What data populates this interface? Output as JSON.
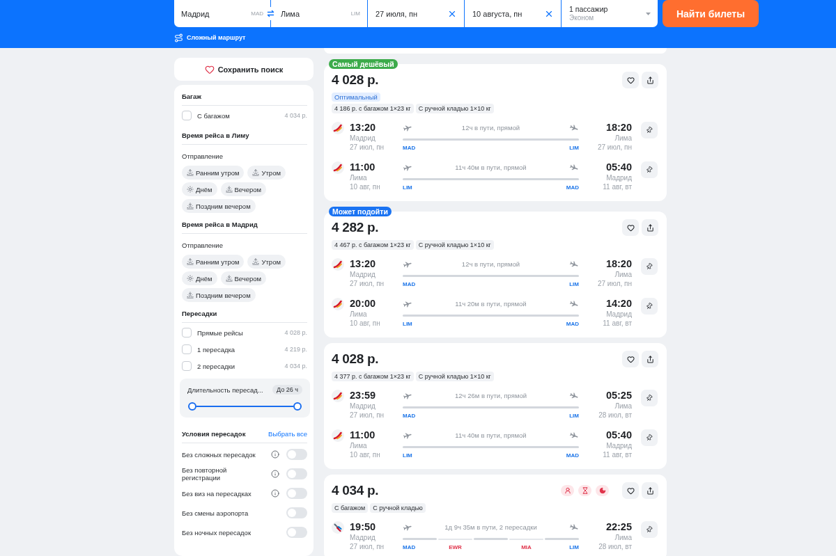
{
  "search_form": {
    "origin": {
      "city": "Мадрид",
      "code": "MAD"
    },
    "destination": {
      "city": "Лима",
      "code": "LIM"
    },
    "departure_date": "27 июля, пн",
    "return_date": "10 августа, пн",
    "passengers": "1 пассажир",
    "cabin_class": "Эконом",
    "search_button": "Найти билеты",
    "complex_route_link": "Сложный маршрут"
  },
  "sidebar": {
    "save_search_button": "Сохранить поиск",
    "sections": [
      {
        "kind": "checkboxes",
        "title": "Багаж",
        "items": [
          {
            "label": "С багажом",
            "price": "4 034 р.",
            "checked": false
          }
        ]
      },
      {
        "kind": "times",
        "title": "Время рейса в Лиму",
        "subtitle": "Отправление",
        "chips": [
          {
            "kind": "sunrise",
            "label": "Ранним утром",
            "selected": false
          },
          {
            "kind": "sunrise",
            "label": "Утром",
            "selected": false
          },
          {
            "kind": "sun",
            "label": "Днём",
            "selected": false
          },
          {
            "kind": "sunset",
            "label": "Вечером",
            "selected": false
          },
          {
            "kind": "sunset",
            "label": "Поздним вечером",
            "selected": false
          }
        ]
      },
      {
        "kind": "times",
        "title": "Время рейса в Мадрид",
        "subtitle": "Отправление",
        "chips": [
          {
            "kind": "sunrise",
            "label": "Ранним утром",
            "selected": false
          },
          {
            "kind": "sunrise",
            "label": "Утром",
            "selected": false
          },
          {
            "kind": "sun",
            "label": "Днём",
            "selected": false
          },
          {
            "kind": "sunset",
            "label": "Вечером",
            "selected": false
          },
          {
            "kind": "sunset",
            "label": "Поздним вечером",
            "selected": false
          }
        ]
      },
      {
        "kind": "checkboxes",
        "title": "Пересадки",
        "items": [
          {
            "label": "Прямые рейсы",
            "price": "4 028 р.",
            "checked": false
          },
          {
            "label": "1 пересадка",
            "price": "4 219 р.",
            "checked": false
          },
          {
            "label": "2 пересадки",
            "price": "4 034 р.",
            "checked": false
          }
        ],
        "duration_filter": {
          "label": "Длительность пересад...",
          "value": "До 26 ч",
          "thumbs": [
            {
              "level": 0
            },
            {
              "level": 1
            }
          ]
        }
      },
      {
        "kind": "toggles",
        "title": "Условия пересадок",
        "action": "Выбрать все",
        "items": [
          {
            "label": "Без сложных пересадок",
            "info": true,
            "on": false
          },
          {
            "label": "Без повторной регистрации",
            "info": true,
            "on": false
          },
          {
            "label": "Без виз на пересадках",
            "info": true,
            "on": false
          },
          {
            "label": "Без смены аэропорта",
            "info": false,
            "on": false
          },
          {
            "label": "Без ночных пересадок",
            "info": false,
            "on": false
          }
        ]
      }
    ]
  },
  "results": [
    {
      "badge": {
        "text": "Самый дешёвый",
        "color": "#3dab4b"
      },
      "price": "4 028 р.",
      "rating_tag": "Оптимальный",
      "tags": [
        "4 186 р. с багажом 1×23 кг",
        "С ручной кладью 1×10 кг"
      ],
      "segments": [
        {
          "airline_logo": {
            "kind": "swoosh"
          },
          "departure_time": "13:20",
          "departure_city": "Мадрид",
          "departure_date": "27 июл, пн",
          "duration": "12ч в пути, прямой",
          "from_code": "MAD",
          "to_code": "LIM",
          "arrival_time": "18:20",
          "arrival_city": "Лима",
          "arrival_date": "27 июл, пн"
        },
        {
          "airline_logo": {
            "kind": "swoosh"
          },
          "departure_time": "11:00",
          "departure_city": "Лима",
          "departure_date": "10 авг, пн",
          "duration": "11ч 40м в пути, прямой",
          "from_code": "LIM",
          "to_code": "MAD",
          "arrival_time": "05:40",
          "arrival_city": "Мадрид",
          "arrival_date": "11 авг, вт"
        }
      ]
    },
    {
      "badge": {
        "text": "Может подойти",
        "color": "#1a73f2"
      },
      "price": "4 282 р.",
      "tags": [
        "4 467 р. с багажом 1×23 кг",
        "С ручной кладью 1×10 кг"
      ],
      "segments": [
        {
          "airline_logo": {
            "kind": "swoosh"
          },
          "departure_time": "13:20",
          "departure_city": "Мадрид",
          "departure_date": "27 июл, пн",
          "duration": "12ч в пути, прямой",
          "from_code": "MAD",
          "to_code": "LIM",
          "arrival_time": "18:20",
          "arrival_city": "Лима",
          "arrival_date": "27 июл, пн"
        },
        {
          "airline_logo": {
            "kind": "swoosh"
          },
          "departure_time": "20:00",
          "departure_city": "Лима",
          "departure_date": "10 авг, пн",
          "duration": "11ч 20м в пути, прямой",
          "from_code": "LIM",
          "to_code": "MAD",
          "arrival_time": "14:20",
          "arrival_city": "Мадрид",
          "arrival_date": "11 авг, вт"
        }
      ]
    },
    {
      "price": "4 028 р.",
      "tags": [
        "4 377 р. с багажом 1×23 кг",
        "С ручной кладью 1×10 кг"
      ],
      "segments": [
        {
          "airline_logo": {
            "kind": "swoosh"
          },
          "departure_time": "23:59",
          "departure_city": "Мадрид",
          "departure_date": "27 июл, пн",
          "duration": "12ч 26м в пути, прямой",
          "from_code": "MAD",
          "to_code": "LIM",
          "arrival_time": "05:25",
          "arrival_city": "Лима",
          "arrival_date": "28 июл, вт"
        },
        {
          "airline_logo": {
            "kind": "swoosh"
          },
          "departure_time": "11:00",
          "departure_city": "Лима",
          "departure_date": "10 авг, пн",
          "duration": "11ч 40м в пути, прямой",
          "from_code": "LIM",
          "to_code": "MAD",
          "arrival_time": "05:40",
          "arrival_city": "Мадрид",
          "arrival_date": "11 авг, вт"
        }
      ]
    },
    {
      "price": "4 034 р.",
      "warnings": [
        {
          "kind": "person"
        },
        {
          "kind": "hourglass"
        },
        {
          "kind": "moon"
        }
      ],
      "tags": [
        "С багажом",
        "С ручной кладью"
      ],
      "segments": [
        {
          "airline_logo": {
            "kind": "stripes"
          },
          "departure_time": "19:50",
          "departure_city": "Мадрид",
          "departure_date": "27 июл, пн",
          "duration": "1д 9ч 35м в пути, 2 пересадки",
          "from_code": "MAD",
          "stops": [
            {
              "code": "EWR"
            },
            {
              "code": "MIA"
            }
          ],
          "to_code": "LIM",
          "arrival_time": "22:25",
          "arrival_city": "Лима",
          "arrival_date": "28 июл, вт"
        }
      ]
    }
  ]
}
